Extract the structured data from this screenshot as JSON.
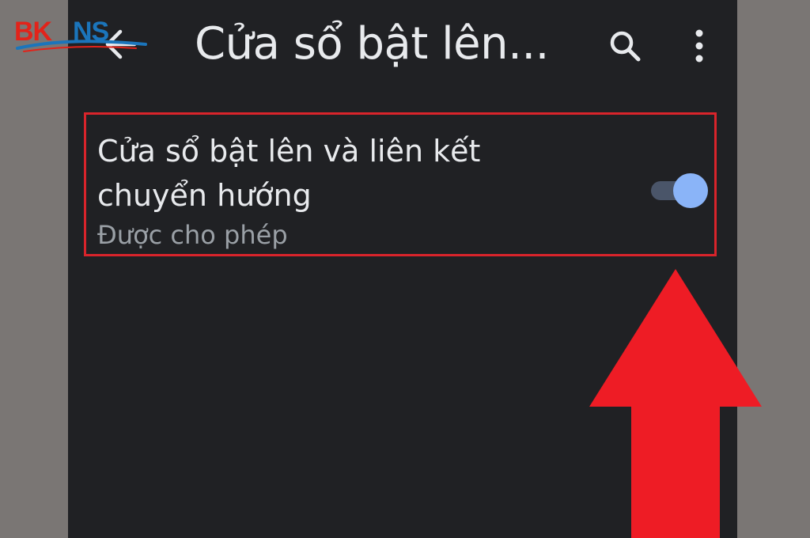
{
  "app_bar": {
    "title": "Cửa sổ bật lên...",
    "back_icon": "arrow-left-icon",
    "search_icon": "search-icon",
    "menu_icon": "more-vert-icon"
  },
  "setting": {
    "title": "Cửa sổ bật lên và liên kết chuyển hướng",
    "summary": "Được cho phép",
    "toggle_on": true
  },
  "logo": {
    "text": "BKNS"
  },
  "colors": {
    "background": "#202124",
    "primary_text": "#e8eaed",
    "secondary_text": "#9aa0a6",
    "toggle_thumb": "#8ab4f8",
    "toggle_track": "#4a5569",
    "highlight": "#d9242b",
    "arrow": "#ee1c25",
    "logo_red": "#e2231a",
    "logo_blue": "#1b75bb"
  }
}
